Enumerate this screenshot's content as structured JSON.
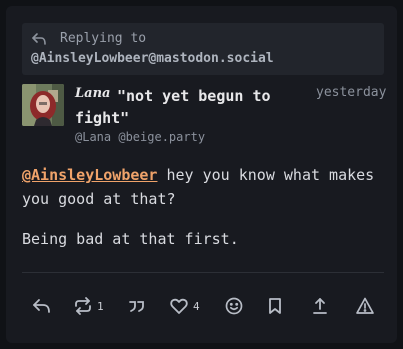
{
  "reply_context": {
    "prefix": "Replying to",
    "handle": "@AinsleyLowbeer@mastodon.social"
  },
  "post": {
    "author_display_name": "Lana",
    "title": "\"not yet begun to fight\"",
    "author_handle": "@Lana @beige.party",
    "timestamp": "yesterday",
    "mention": "@AinsleyLowbeer",
    "line1_rest": " hey you know what makes you good at that?",
    "line2": "Being bad at that first."
  },
  "actions": {
    "boost_count": "1",
    "favourite_count": "4"
  },
  "icons": [
    "reply-icon",
    "boost-icon",
    "quote-icon",
    "favourite-icon",
    "emoji-react-icon",
    "bookmark-icon",
    "share-icon",
    "report-icon"
  ],
  "colors": {
    "background": "#101216",
    "card": "#181a20",
    "mention": "#f0a36a",
    "text": "#d9dbe0"
  }
}
